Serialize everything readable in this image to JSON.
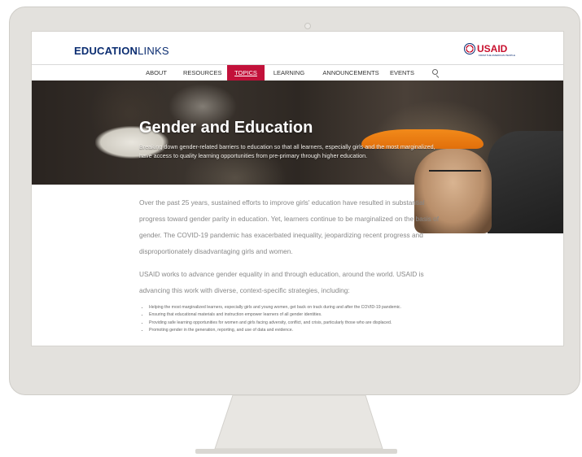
{
  "site": {
    "logo_bold": "EDUCATION",
    "logo_light": "LINKS",
    "partner": "USAID",
    "partner_sub": "FROM THE AMERICAN PEOPLE"
  },
  "nav": {
    "items": [
      "ABOUT",
      "RESOURCES",
      "TOPICS",
      "LEARNING",
      "ANNOUNCEMENTS",
      "EVENTS"
    ],
    "active": "TOPICS"
  },
  "hero": {
    "title": "Gender and Education",
    "description": "Breaking down gender-related barriers to education so that all learners, especially girls and the most marginalized, have access to quality learning opportunities from pre-primary through higher education."
  },
  "body": {
    "paragraph_1": "Over the past 25 years, sustained efforts to improve girls' education have resulted in substantial progress toward gender parity in education. Yet, learners continue to be marginalized on the basis of gender. The COVID-19 pandemic has exacerbated inequality, jeopardizing recent progress and disproportionately disadvantaging girls and women.",
    "paragraph_2": "USAID works to advance gender equality in and through education, around the world. USAID is advancing this work with diverse, context-specific strategies, including:",
    "bullets": [
      "Helping the most marginalized learners, especially girls and young women, get back on track during and after the COVID-19 pandemic.",
      "Ensuring that educational materials and instruction empower learners of all gender identities.",
      "Providing safe learning opportunities for women and girls facing adversity, conflict, and crisis, particularly those who are displaced.",
      "Promoting gender in the generation, reporting, and use of data and evidence."
    ]
  },
  "colors": {
    "brand_navy": "#0b2d71",
    "accent_red": "#c2113a",
    "frame": "#e3e1dd"
  }
}
